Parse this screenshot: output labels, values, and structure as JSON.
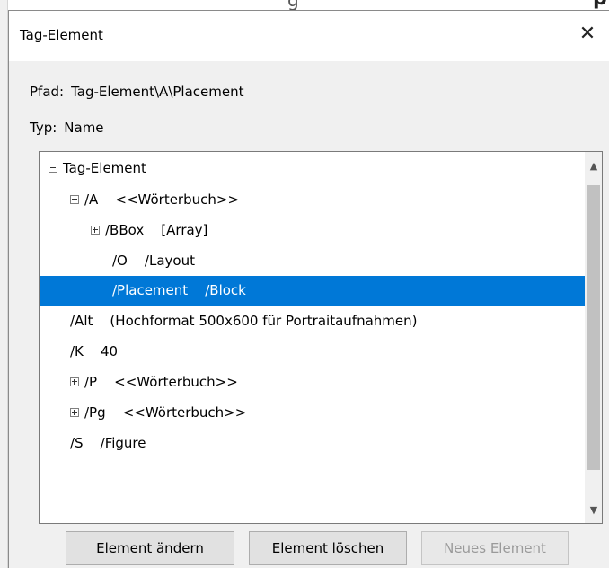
{
  "background": {
    "partial_title": "g",
    "partial_bold": "p"
  },
  "dialog": {
    "title": "Tag-Element",
    "close_glyph": "✕",
    "path_label": "Pfad:",
    "path_value": "Tag-Element\\A\\Placement",
    "type_label": "Typ:",
    "type_value": "Name"
  },
  "tree": {
    "rows": [
      {
        "text": "Tag-Element",
        "expander": "minus"
      },
      {
        "text": "/A    <<Wörterbuch>>",
        "expander": "minus"
      },
      {
        "text": "/BBox    [Array]",
        "expander": "plus"
      },
      {
        "text": "/O    /Layout",
        "expander": "none"
      },
      {
        "text": "/Placement    /Block",
        "expander": "none",
        "selected": true
      },
      {
        "text": "/Alt    (Hochformat 500x600 für Portraitaufnahmen)",
        "expander": "none"
      },
      {
        "text": "/K    40",
        "expander": "none"
      },
      {
        "text": "/P    <<Wörterbuch>>",
        "expander": "plus"
      },
      {
        "text": "/Pg    <<Wörterbuch>>",
        "expander": "plus"
      },
      {
        "text": "/S    /Figure",
        "expander": "none"
      }
    ]
  },
  "buttons": {
    "edit": "Element ändern",
    "delete": "Element löschen",
    "new": "Neues Element"
  },
  "colors": {
    "selection": "#0078d7"
  }
}
